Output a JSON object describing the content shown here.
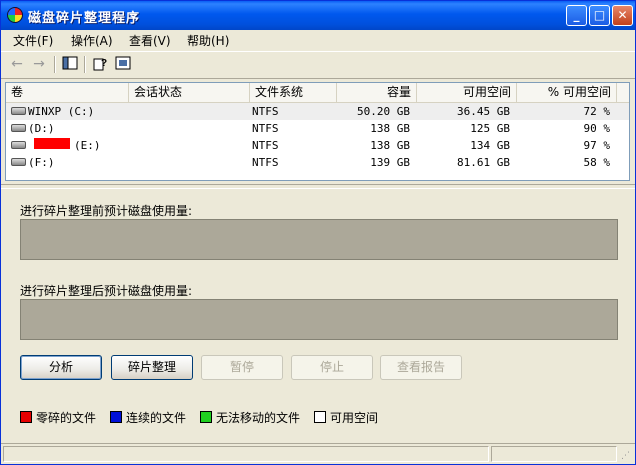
{
  "window": {
    "title": "磁盘碎片整理程序",
    "controls": {
      "minimize": "_",
      "maximize": "□",
      "close": "✕"
    }
  },
  "menu": [
    "文件(F)",
    "操作(A)",
    "查看(V)",
    "帮助(H)"
  ],
  "toolbar": {
    "back_icon": "back-arrow-icon",
    "forward_icon": "forward-arrow-icon",
    "view_icon": "view-pane-icon",
    "help_icon": "help-icon",
    "properties_icon": "properties-icon"
  },
  "volumes": {
    "columns": [
      "卷",
      "会话状态",
      "文件系统",
      "容量",
      "可用空间",
      "% 可用空间"
    ],
    "rows": [
      {
        "volume": "WINXP (C:)",
        "status": "",
        "fs": "NTFS",
        "capacity": "50.20 GB",
        "free": "36.45 GB",
        "pct": "72 %"
      },
      {
        "volume": "(D:)",
        "status": "",
        "fs": "NTFS",
        "capacity": "138 GB",
        "free": "125 GB",
        "pct": "90 %"
      },
      {
        "volume": "(E:)",
        "status": "",
        "fs": "NTFS",
        "capacity": "138 GB",
        "free": "134 GB",
        "pct": "97 %"
      },
      {
        "volume": "(F:)",
        "status": "",
        "fs": "NTFS",
        "capacity": "139 GB",
        "free": "81.61 GB",
        "pct": "58 %"
      }
    ]
  },
  "analysis": {
    "before_label": "进行碎片整理前预计磁盘使用量:",
    "after_label": "进行碎片整理后预计磁盘使用量:"
  },
  "buttons": {
    "analyze": "分析",
    "defrag": "碎片整理",
    "pause": "暂停",
    "stop": "停止",
    "report": "查看报告"
  },
  "legend": [
    {
      "label": "零碎的文件",
      "color": "#E60000"
    },
    {
      "label": "连续的文件",
      "color": "#0010D8"
    },
    {
      "label": "无法移动的文件",
      "color": "#20D020"
    },
    {
      "label": "可用空间",
      "color": "#FFFFFF"
    }
  ]
}
